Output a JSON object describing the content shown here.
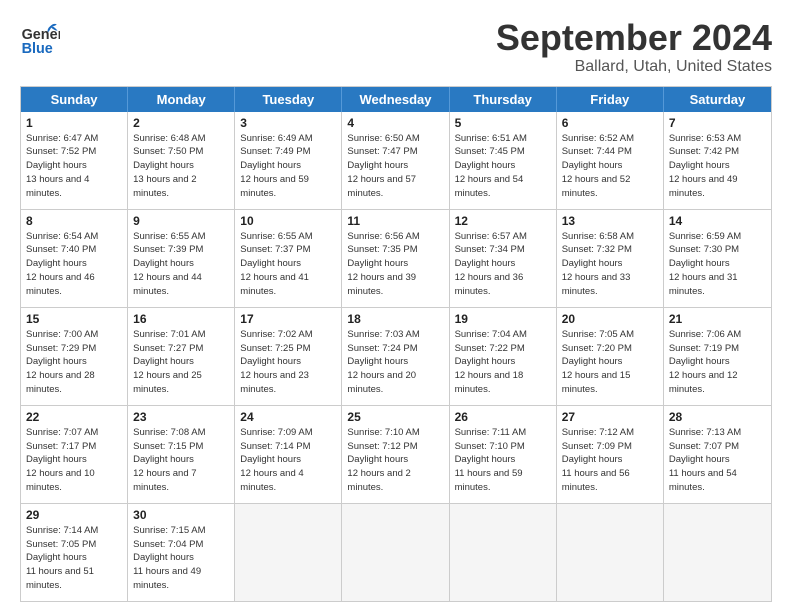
{
  "header": {
    "logo_general": "General",
    "logo_blue": "Blue",
    "month": "September 2024",
    "location": "Ballard, Utah, United States"
  },
  "days_of_week": [
    "Sunday",
    "Monday",
    "Tuesday",
    "Wednesday",
    "Thursday",
    "Friday",
    "Saturday"
  ],
  "weeks": [
    [
      {
        "day": "1",
        "rise": "6:47 AM",
        "set": "7:52 PM",
        "daylight": "13 hours and 4 minutes."
      },
      {
        "day": "2",
        "rise": "6:48 AM",
        "set": "7:50 PM",
        "daylight": "13 hours and 2 minutes."
      },
      {
        "day": "3",
        "rise": "6:49 AM",
        "set": "7:49 PM",
        "daylight": "12 hours and 59 minutes."
      },
      {
        "day": "4",
        "rise": "6:50 AM",
        "set": "7:47 PM",
        "daylight": "12 hours and 57 minutes."
      },
      {
        "day": "5",
        "rise": "6:51 AM",
        "set": "7:45 PM",
        "daylight": "12 hours and 54 minutes."
      },
      {
        "day": "6",
        "rise": "6:52 AM",
        "set": "7:44 PM",
        "daylight": "12 hours and 52 minutes."
      },
      {
        "day": "7",
        "rise": "6:53 AM",
        "set": "7:42 PM",
        "daylight": "12 hours and 49 minutes."
      }
    ],
    [
      {
        "day": "8",
        "rise": "6:54 AM",
        "set": "7:40 PM",
        "daylight": "12 hours and 46 minutes."
      },
      {
        "day": "9",
        "rise": "6:55 AM",
        "set": "7:39 PM",
        "daylight": "12 hours and 44 minutes."
      },
      {
        "day": "10",
        "rise": "6:55 AM",
        "set": "7:37 PM",
        "daylight": "12 hours and 41 minutes."
      },
      {
        "day": "11",
        "rise": "6:56 AM",
        "set": "7:35 PM",
        "daylight": "12 hours and 39 minutes."
      },
      {
        "day": "12",
        "rise": "6:57 AM",
        "set": "7:34 PM",
        "daylight": "12 hours and 36 minutes."
      },
      {
        "day": "13",
        "rise": "6:58 AM",
        "set": "7:32 PM",
        "daylight": "12 hours and 33 minutes."
      },
      {
        "day": "14",
        "rise": "6:59 AM",
        "set": "7:30 PM",
        "daylight": "12 hours and 31 minutes."
      }
    ],
    [
      {
        "day": "15",
        "rise": "7:00 AM",
        "set": "7:29 PM",
        "daylight": "12 hours and 28 minutes."
      },
      {
        "day": "16",
        "rise": "7:01 AM",
        "set": "7:27 PM",
        "daylight": "12 hours and 25 minutes."
      },
      {
        "day": "17",
        "rise": "7:02 AM",
        "set": "7:25 PM",
        "daylight": "12 hours and 23 minutes."
      },
      {
        "day": "18",
        "rise": "7:03 AM",
        "set": "7:24 PM",
        "daylight": "12 hours and 20 minutes."
      },
      {
        "day": "19",
        "rise": "7:04 AM",
        "set": "7:22 PM",
        "daylight": "12 hours and 18 minutes."
      },
      {
        "day": "20",
        "rise": "7:05 AM",
        "set": "7:20 PM",
        "daylight": "12 hours and 15 minutes."
      },
      {
        "day": "21",
        "rise": "7:06 AM",
        "set": "7:19 PM",
        "daylight": "12 hours and 12 minutes."
      }
    ],
    [
      {
        "day": "22",
        "rise": "7:07 AM",
        "set": "7:17 PM",
        "daylight": "12 hours and 10 minutes."
      },
      {
        "day": "23",
        "rise": "7:08 AM",
        "set": "7:15 PM",
        "daylight": "12 hours and 7 minutes."
      },
      {
        "day": "24",
        "rise": "7:09 AM",
        "set": "7:14 PM",
        "daylight": "12 hours and 4 minutes."
      },
      {
        "day": "25",
        "rise": "7:10 AM",
        "set": "7:12 PM",
        "daylight": "12 hours and 2 minutes."
      },
      {
        "day": "26",
        "rise": "7:11 AM",
        "set": "7:10 PM",
        "daylight": "11 hours and 59 minutes."
      },
      {
        "day": "27",
        "rise": "7:12 AM",
        "set": "7:09 PM",
        "daylight": "11 hours and 56 minutes."
      },
      {
        "day": "28",
        "rise": "7:13 AM",
        "set": "7:07 PM",
        "daylight": "11 hours and 54 minutes."
      }
    ],
    [
      {
        "day": "29",
        "rise": "7:14 AM",
        "set": "7:05 PM",
        "daylight": "11 hours and 51 minutes."
      },
      {
        "day": "30",
        "rise": "7:15 AM",
        "set": "7:04 PM",
        "daylight": "11 hours and 49 minutes."
      },
      null,
      null,
      null,
      null,
      null
    ]
  ]
}
